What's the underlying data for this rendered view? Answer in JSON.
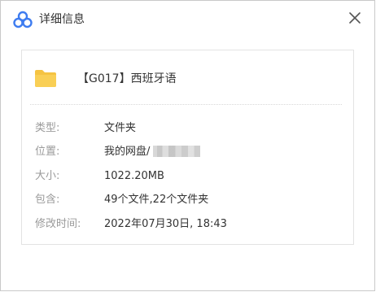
{
  "window": {
    "title": "详细信息",
    "app_icon": "cloud-app-logo-icon",
    "close_icon": "close-icon"
  },
  "item": {
    "icon": "folder-icon",
    "name": "【G017】西班牙语"
  },
  "details": [
    {
      "label": "类型:",
      "value": "文件夹"
    },
    {
      "label": "位置:",
      "value": "我的网盘/"
    },
    {
      "label": "大小:",
      "value": "1022.20MB"
    },
    {
      "label": "包含:",
      "value": "49个文件,22个文件夹"
    },
    {
      "label": "修改时间:",
      "value": "2022年07月30日, 18:43"
    }
  ],
  "colors": {
    "folder": "#f5c342",
    "logo_blue": "#3e7cf0",
    "label_gray": "#9a9a9a"
  }
}
